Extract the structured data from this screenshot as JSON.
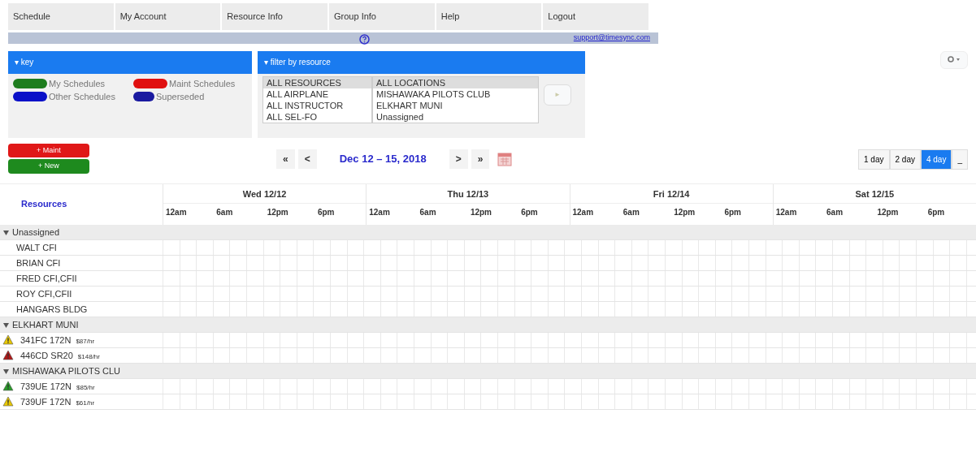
{
  "menu": [
    {
      "label": "Schedule"
    },
    {
      "label": "My Account"
    },
    {
      "label": "Resource Info"
    },
    {
      "label": "Group Info"
    },
    {
      "label": "Help"
    },
    {
      "label": "Logout"
    }
  ],
  "banner": {
    "email": "support@timesync.com"
  },
  "key_panel": {
    "title": "▾ key",
    "legend": [
      {
        "label": "My Schedules",
        "color": "#1e7d1e"
      },
      {
        "label": "Maint Schedules",
        "color": "#e01010"
      },
      {
        "label": "Other Schedules",
        "color": "#0a10c8"
      },
      {
        "label": "Superseded",
        "color": "#1a1aa0"
      }
    ]
  },
  "filter_panel": {
    "title": "▾ filter by resource",
    "resources": [
      {
        "label": "ALL RESOURCES",
        "selected": true
      },
      {
        "label": "ALL AIRPLANE",
        "selected": false
      },
      {
        "label": "ALL INSTRUCTOR",
        "selected": false
      },
      {
        "label": "ALL SEL-FO",
        "selected": false
      }
    ],
    "locations": [
      {
        "label": "ALL LOCATIONS",
        "selected": true
      },
      {
        "label": "MISHAWAKA PILOTS CLUB",
        "selected": false
      },
      {
        "label": "ELKHART MUNI",
        "selected": false
      },
      {
        "label": "Unassigned",
        "selected": false
      }
    ],
    "apply": "►"
  },
  "actions": [
    {
      "label": "+ Maint",
      "kind": "maint"
    },
    {
      "label": "+ New",
      "kind": "new"
    }
  ],
  "date_nav": {
    "first": "«",
    "prev": "<",
    "range": "Dec 12 – 15, 2018",
    "next": ">",
    "last": "»"
  },
  "views": [
    {
      "label": "1 day",
      "selected": false
    },
    {
      "label": "2 day",
      "selected": false
    },
    {
      "label": "4 day",
      "selected": true
    },
    {
      "label": "_",
      "selected": false
    }
  ],
  "grid": {
    "resources_label": "Resources",
    "days": [
      {
        "label": "Wed 12/12",
        "hours": [
          "12am",
          "6am",
          "12pm",
          "6pm"
        ]
      },
      {
        "label": "Thu 12/13",
        "hours": [
          "12am",
          "6am",
          "12pm",
          "6pm"
        ]
      },
      {
        "label": "Fri 12/14",
        "hours": [
          "12am",
          "6am",
          "12pm",
          "6pm"
        ]
      },
      {
        "label": "Sat 12/15",
        "hours": [
          "12am",
          "6am",
          "12pm",
          "6pm"
        ]
      }
    ],
    "groups": [
      {
        "name": "Unassigned",
        "expanded": true,
        "children": [
          {
            "name": "WALT CFI"
          },
          {
            "name": "BRIAN CFI"
          },
          {
            "name": "FRED CFI,CFII"
          },
          {
            "name": "ROY CFI,CFII"
          },
          {
            "name": "HANGARS BLDG"
          }
        ]
      },
      {
        "name": "ELKHART MUNI",
        "expanded": true,
        "children": [
          {
            "name": "341FC 172N",
            "rate": "$87/hr",
            "color": "#e8c800"
          },
          {
            "name": "446CD SR20",
            "rate": "$148/hr",
            "color": "#b01818"
          }
        ]
      },
      {
        "name": "MISHAWAKA PILOTS CLU",
        "expanded": true,
        "children": [
          {
            "name": "739UE 172N",
            "rate": "$85/hr",
            "color": "#2a9a2a"
          },
          {
            "name": "739UF 172N",
            "rate": "$61/hr",
            "color": "#e8c800"
          }
        ]
      }
    ]
  }
}
